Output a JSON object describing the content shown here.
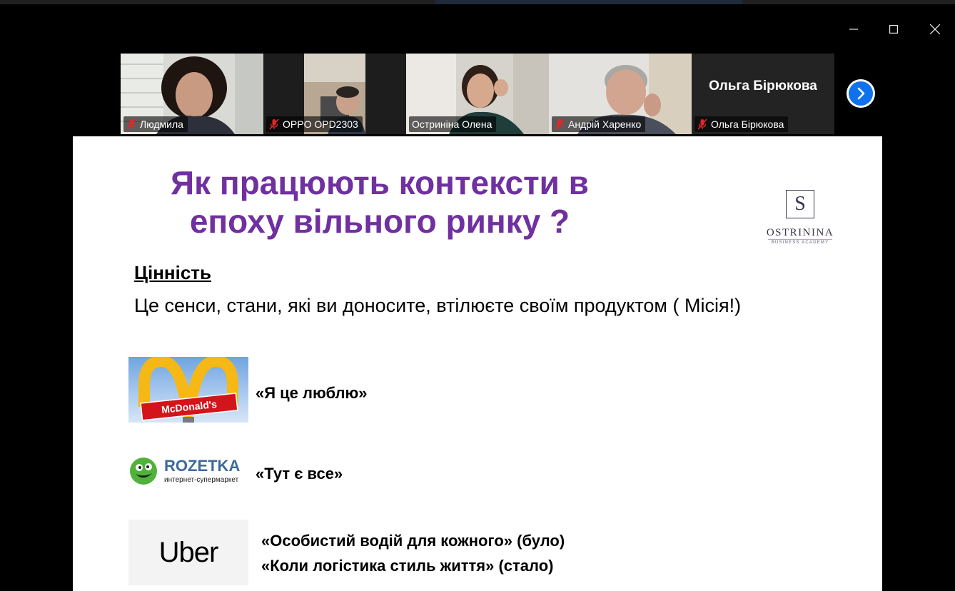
{
  "window": {
    "controls": [
      "minimize",
      "maximize",
      "close"
    ]
  },
  "participants": [
    {
      "name": "Людмила",
      "muted": true,
      "video": true
    },
    {
      "name": "OPPO OPD2303",
      "muted": true,
      "video": true
    },
    {
      "name": "Остриніна Олена",
      "muted": false,
      "video": true,
      "active_speaker": true
    },
    {
      "name": "Андрій Харенко",
      "muted": true,
      "video": true
    },
    {
      "name": "Ольга Бірюкова",
      "muted": true,
      "video": false,
      "display_name": "Ольга Бірюкова"
    }
  ],
  "colors": {
    "accent": "#0e72ed",
    "active_border": "#23d160",
    "title": "#7030a0"
  },
  "slide": {
    "title": "Як працюють контексти в епоху вільного ринку ?",
    "logo": {
      "brand": "OSTRININA",
      "sub": "BUSINESS ACADEMY"
    },
    "heading": "Цінність",
    "text": "Це сенси, стани, які ви доносите, втілюєте своїм продуктом ( Місія!)",
    "examples": [
      {
        "brand": "McDonald's",
        "quote": "«Я це люблю»"
      },
      {
        "brand": "ROZETKA",
        "brand_sub": "интернет-супермаркет",
        "quote": "«Тут є все»"
      },
      {
        "brand": "Uber",
        "quote_1": "«Особистий водій для кожного» (було)",
        "quote_2": "«Коли логістика стиль життя» (стало)"
      }
    ]
  }
}
